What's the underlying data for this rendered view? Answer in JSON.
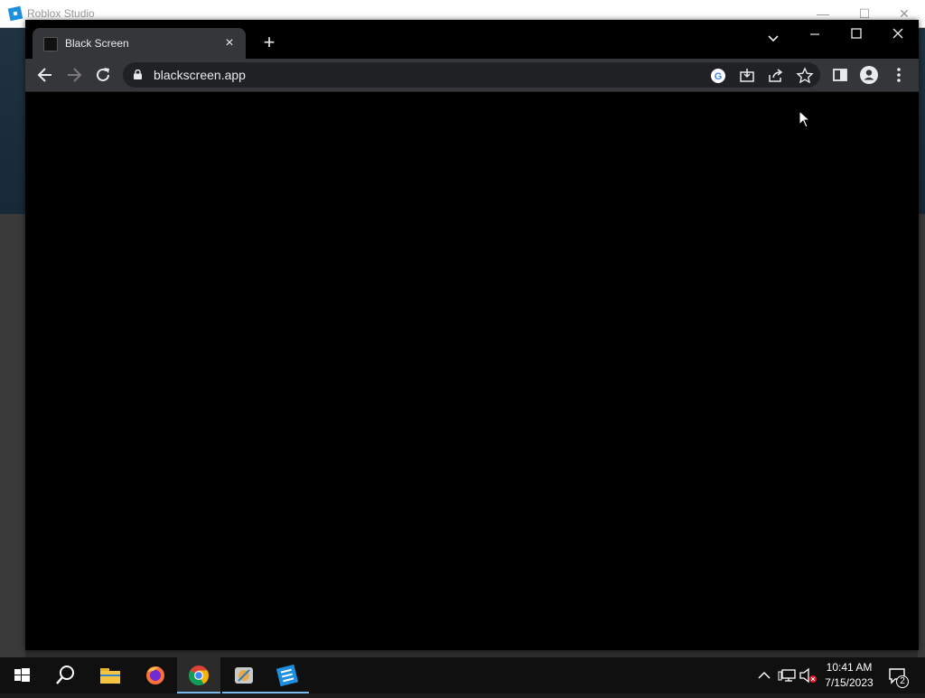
{
  "background_app": {
    "title": "Roblox Studio",
    "controls": [
      "minimize",
      "maximize",
      "close"
    ]
  },
  "browser": {
    "tab": {
      "title": "Black Screen",
      "close_label": "×"
    },
    "new_tab_label": "+",
    "omnibox": {
      "url": "blackscreen.app"
    },
    "toolbar_icons": [
      "back-icon",
      "forward-icon",
      "reload-icon",
      "lock-icon",
      "google-lens-icon",
      "install-app-icon",
      "share-icon",
      "bookmark-star-icon",
      "side-panel-icon",
      "profile-icon",
      "menu-icon"
    ],
    "page_background": "#000000"
  },
  "taskbar": {
    "apps": [
      "start-icon",
      "search-icon",
      "file-explorer-icon",
      "firefox-icon",
      "chrome-icon",
      "paint-icon",
      "roblox-studio-icon"
    ],
    "active_app": "chrome",
    "clock": {
      "time": "10:41 AM",
      "date": "7/15/2023"
    },
    "notification_count": "2"
  },
  "colors": {
    "chrome_toolbar": "#35363a",
    "chrome_frame": "#000000",
    "taskbar": "#101010",
    "accent": "#76b9ed"
  }
}
